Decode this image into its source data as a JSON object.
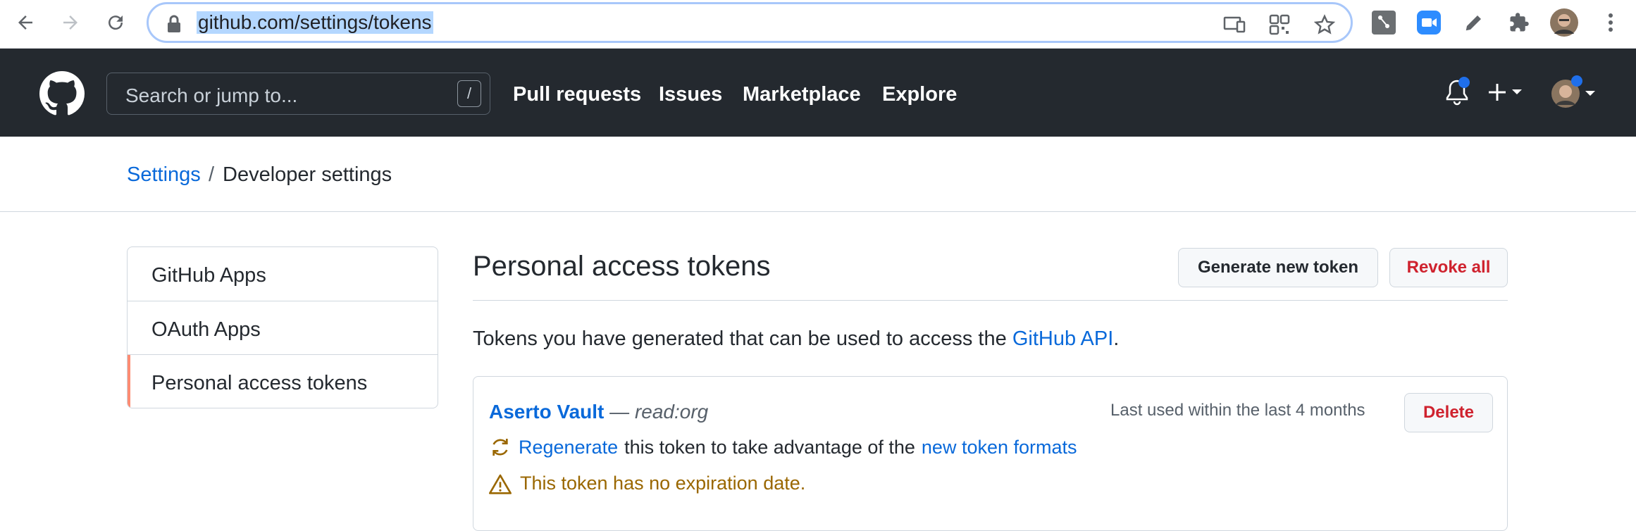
{
  "browser": {
    "url": "github.com/settings/tokens"
  },
  "header": {
    "search_placeholder": "Search or jump to...",
    "search_shortcut": "/",
    "nav": [
      "Pull requests",
      "Issues",
      "Marketplace",
      "Explore"
    ]
  },
  "breadcrumb": {
    "settings": "Settings",
    "separator": "/",
    "current": "Developer settings"
  },
  "sidebar": {
    "items": [
      {
        "label": "GitHub Apps"
      },
      {
        "label": "OAuth Apps"
      },
      {
        "label": "Personal access tokens"
      }
    ],
    "active_index": 2
  },
  "main": {
    "title": "Personal access tokens",
    "generate_button": "Generate new token",
    "revoke_button": "Revoke all",
    "intro_text": "Tokens you have generated that can be used to access the",
    "intro_link": "GitHub API",
    "intro_period": "."
  },
  "token": {
    "name": "Aserto Vault",
    "dash": "—",
    "scope": "read:org",
    "last_used": "Last used within the last 4 months",
    "delete_button": "Delete",
    "regenerate_link": "Regenerate",
    "regenerate_text": "this token to take advantage of the",
    "formats_link": "new token formats",
    "warning": "This token has no expiration date."
  },
  "colors": {
    "link": "#0969da",
    "danger": "#cf222e",
    "warning": "#9a6700",
    "header_bg": "#24292f",
    "notification_dot": "#1f6feb",
    "active_marker": "#fd8c73"
  },
  "icons": [
    "back-icon",
    "forward-icon",
    "reload-icon",
    "lock-icon",
    "cast-icon",
    "qr-icon",
    "star-icon",
    "extension-icon",
    "zoom-icon",
    "pen-icon",
    "puzzle-icon",
    "profile-avatar",
    "more-icon",
    "github-logo",
    "bell-icon",
    "plus-icon",
    "avatar",
    "regenerate-icon",
    "warning-icon"
  ]
}
